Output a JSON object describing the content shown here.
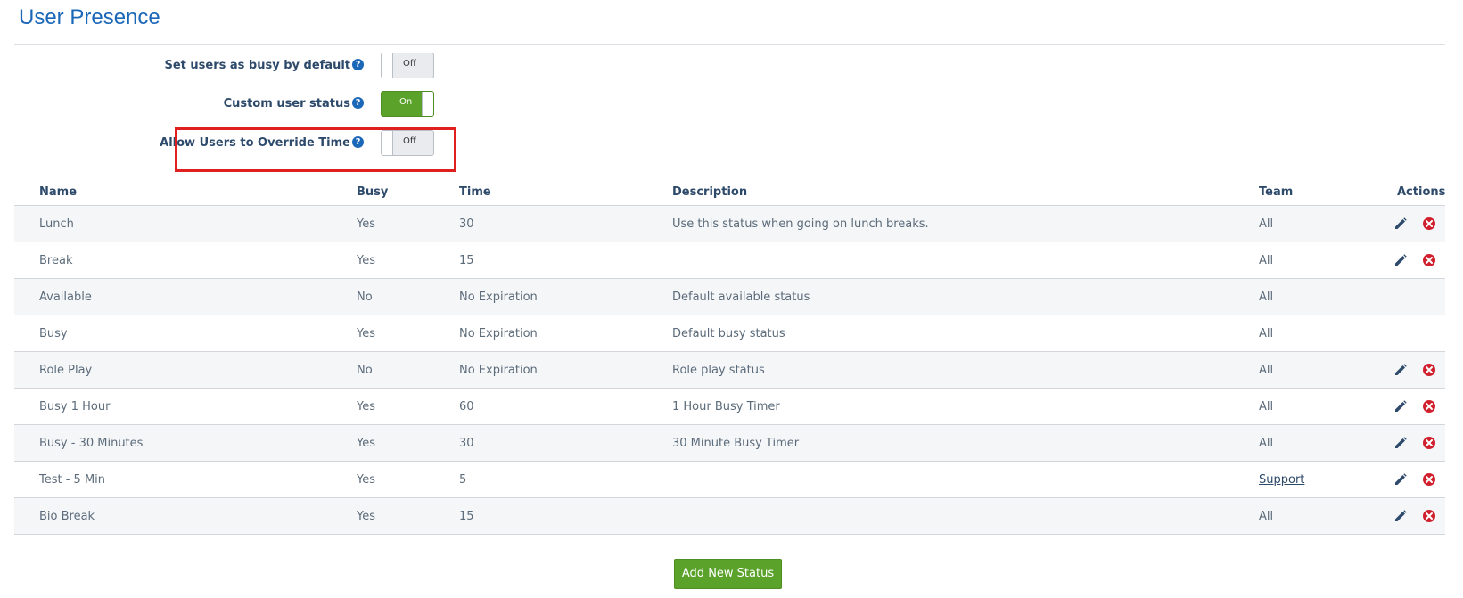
{
  "header": {
    "title": "User Presence"
  },
  "settings": [
    {
      "label": "Set users as busy by default",
      "state": "Off",
      "on": false
    },
    {
      "label": "Custom user status",
      "state": "On",
      "on": true
    },
    {
      "label": "Allow Users to Override Time",
      "state": "Off",
      "on": false
    }
  ],
  "table": {
    "columns": {
      "name": "Name",
      "busy": "Busy",
      "time": "Time",
      "description": "Description",
      "team": "Team",
      "actions": "Actions"
    },
    "rows": [
      {
        "name": "Lunch",
        "busy": "Yes",
        "time": "30",
        "description": "Use this status when going on lunch breaks.",
        "team": "All",
        "team_link": false,
        "actions": true
      },
      {
        "name": "Break",
        "busy": "Yes",
        "time": "15",
        "description": "",
        "team": "All",
        "team_link": false,
        "actions": true
      },
      {
        "name": "Available",
        "busy": "No",
        "time": "No Expiration",
        "description": "Default available status",
        "team": "All",
        "team_link": false,
        "actions": false
      },
      {
        "name": "Busy",
        "busy": "Yes",
        "time": "No Expiration",
        "description": "Default busy status",
        "team": "All",
        "team_link": false,
        "actions": false
      },
      {
        "name": "Role Play",
        "busy": "No",
        "time": "No Expiration",
        "description": "Role play status",
        "team": "All",
        "team_link": false,
        "actions": true
      },
      {
        "name": "Busy 1 Hour",
        "busy": "Yes",
        "time": "60",
        "description": "1 Hour Busy Timer",
        "team": "All",
        "team_link": false,
        "actions": true
      },
      {
        "name": "Busy - 30 Minutes",
        "busy": "Yes",
        "time": "30",
        "description": "30 Minute Busy Timer",
        "team": "All",
        "team_link": false,
        "actions": true
      },
      {
        "name": "Test - 5 Min",
        "busy": "Yes",
        "time": "5",
        "description": "",
        "team": "Support",
        "team_link": true,
        "actions": true
      },
      {
        "name": "Bio Break",
        "busy": "Yes",
        "time": "15",
        "description": "",
        "team": "All",
        "team_link": false,
        "actions": true
      }
    ]
  },
  "footer": {
    "add_label": "Add New Status"
  },
  "colors": {
    "title": "#1b67b8",
    "toggle_on": "#5aa229",
    "highlight": "#e0201f",
    "delete_icon": "#d0202e"
  }
}
